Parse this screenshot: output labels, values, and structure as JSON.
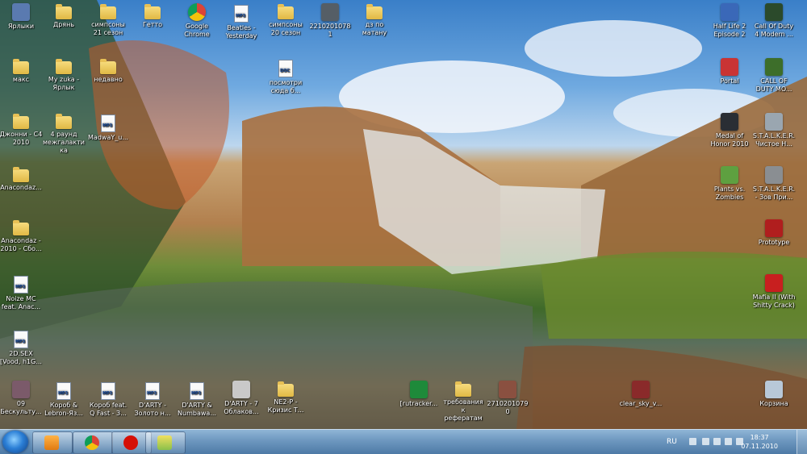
{
  "desktop": {
    "icons": [
      {
        "label": "Ярлыки",
        "kind": "app",
        "color": "#5a7ab0"
      },
      {
        "label": "Дрянь",
        "kind": "folder"
      },
      {
        "label": "симпсоны 21 сезон",
        "kind": "folder"
      },
      {
        "label": "Гетто",
        "kind": "folder"
      },
      {
        "label": "Google Chrome",
        "kind": "chrome"
      },
      {
        "label": "Beatles - Yesterday",
        "kind": "file",
        "tag": "MP3"
      },
      {
        "label": "симпсоны 20 сезон",
        "kind": "folder"
      },
      {
        "label": "22102010781",
        "kind": "app",
        "color": "#555e66"
      },
      {
        "label": "дз по матану",
        "kind": "folder"
      },
      {
        "label": "Half Life 2 Episode 2",
        "kind": "app",
        "color": "#3a68b8"
      },
      {
        "label": "Call Of Duty 4 Modern ...",
        "kind": "app",
        "color": "#2b4a2b"
      },
      {
        "label": "макс",
        "kind": "folder"
      },
      {
        "label": "My zuka - Ярлык",
        "kind": "folder"
      },
      {
        "label": "недавно",
        "kind": "folder"
      },
      {
        "label": "посмотри сюда б...",
        "kind": "file",
        "tag": "DOC"
      },
      {
        "label": "Portal",
        "kind": "app",
        "color": "#c93434"
      },
      {
        "label": "CALL OF DUTY MO...",
        "kind": "app",
        "color": "#3d6e2a"
      },
      {
        "label": "Джонни - С4 2010",
        "kind": "folder"
      },
      {
        "label": "4 раунд межгалакти ка",
        "kind": "folder"
      },
      {
        "label": "MadwaY_u...",
        "kind": "file",
        "tag": "MP3"
      },
      {
        "label": "Medal of Honor 2010",
        "kind": "app",
        "color": "#2a2e34"
      },
      {
        "label": "S.T.A.L.K.E.R. Чистое Н...",
        "kind": "app",
        "color": "#9aa6b0"
      },
      {
        "label": "Anacondaz...",
        "kind": "folder"
      },
      {
        "label": "Plants vs. Zombies",
        "kind": "app",
        "color": "#5ea040"
      },
      {
        "label": "S.T.A.L.K.E.R. - Зов При...",
        "kind": "app",
        "color": "#8a8e92"
      },
      {
        "label": "Anacondaz - 2010 - Сбо...",
        "kind": "folder"
      },
      {
        "label": "Prototype",
        "kind": "app",
        "color": "#b01e1e"
      },
      {
        "label": "Noize MC feat. Anac...",
        "kind": "file",
        "tag": "MP3"
      },
      {
        "label": "Mafia II (With Shitty Crack)",
        "kind": "app",
        "color": "#c81f1f"
      },
      {
        "label": "2D.SEX [Vood, h1G...",
        "kind": "file",
        "tag": "MP3"
      },
      {
        "label": "09 Бескульту...",
        "kind": "app",
        "color": "#7b5a6a"
      },
      {
        "label": "Короб & Lebron-Яз...",
        "kind": "file",
        "tag": "MP3"
      },
      {
        "label": "Короб feat. Q Fast - З...",
        "kind": "file",
        "tag": "MP3"
      },
      {
        "label": "D'ARTY - Золото н...",
        "kind": "file",
        "tag": "MP3"
      },
      {
        "label": "D'ARTY & Numbawa...",
        "kind": "file",
        "tag": "MP3"
      },
      {
        "label": "D'ARTY - 7 Облаков...",
        "kind": "app",
        "color": "#c9c9c9"
      },
      {
        "label": "NE2-P - Кризис Т...",
        "kind": "folder"
      },
      {
        "label": "[rutracker...",
        "kind": "app",
        "color": "#1e8a3a"
      },
      {
        "label": "требования к рефератам",
        "kind": "folder"
      },
      {
        "label": "27102010790",
        "kind": "app",
        "color": "#8a5040"
      },
      {
        "label": "clear_sky_v...",
        "kind": "app",
        "color": "#8a2a2a"
      },
      {
        "label": "Корзина",
        "kind": "app",
        "color": "#b8c8d8"
      }
    ]
  },
  "taskbar": {
    "language": "RU",
    "time": "18:37",
    "date": "07.11.2010",
    "pinned": [
      "media-player",
      "chrome",
      "lastfm",
      "game-app"
    ]
  }
}
